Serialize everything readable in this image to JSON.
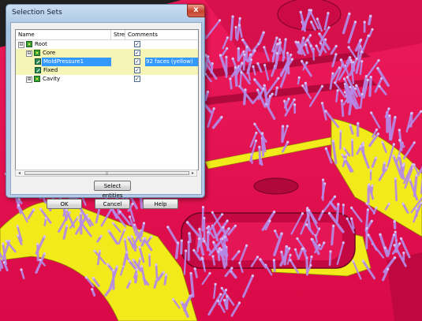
{
  "dialog": {
    "title": "Selection Sets",
    "close_glyph": "x",
    "columns": {
      "name": "Name",
      "stream": "Stre...",
      "comments": "Comments"
    },
    "rows": [
      {
        "label": "Root",
        "expander": "⊟",
        "checked": true,
        "comment": ""
      },
      {
        "label": "Core",
        "expander": "⊟",
        "checked": true,
        "comment": ""
      },
      {
        "label": "MoldPressure1",
        "expander": "",
        "checked": true,
        "comment": "92 faces (yellow)"
      },
      {
        "label": "Fixed",
        "expander": "",
        "checked": true,
        "comment": ""
      },
      {
        "label": "Cavity",
        "expander": "⊞",
        "checked": true,
        "comment": ""
      }
    ],
    "check_glyph": "✓",
    "scroll": {
      "left": "◂",
      "right": "▸",
      "thumb_grip": "|||"
    },
    "buttons": {
      "select_entities": "Select entities",
      "ok": "OK",
      "cancel": "Cancel",
      "help": "Help"
    }
  },
  "viewport": {
    "surface_color": "#e0104f",
    "highlight_color": "#f2ea1b",
    "vector_color": "#b58ae6"
  }
}
